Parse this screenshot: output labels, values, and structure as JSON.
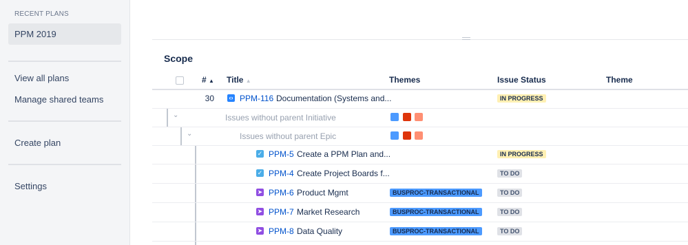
{
  "sidebar": {
    "heading": "RECENT PLANS",
    "active_plan": "PPM 2019",
    "links": {
      "view_all": "View all plans",
      "manage_teams": "Manage shared teams",
      "create": "Create plan",
      "settings": "Settings"
    }
  },
  "main": {
    "section_title": "Scope",
    "columns": {
      "num": "#",
      "title": "Title",
      "themes": "Themes",
      "status": "Issue Status",
      "theme": "Theme"
    },
    "rows": [
      {
        "type": "issue",
        "num": "30",
        "icon": "epic-icon",
        "key": "PPM-116",
        "title": "Documentation (Systems and...",
        "status": "IN PROGRESS",
        "theme_tag": ""
      },
      {
        "type": "group",
        "label": "Issues without parent Initiative"
      },
      {
        "type": "group",
        "label": "Issues without parent Epic"
      },
      {
        "type": "issue",
        "icon": "task-checkbox-icon",
        "key": "PPM-5",
        "title": "Create a PPM Plan and...",
        "status": "IN PROGRESS",
        "theme_tag": ""
      },
      {
        "type": "issue",
        "icon": "task-checkbox-icon",
        "key": "PPM-4",
        "title": "Create Project Boards f...",
        "status": "TO DO",
        "theme_tag": ""
      },
      {
        "type": "issue",
        "icon": "story-bolt-icon",
        "key": "PPM-6",
        "title": "Product Mgmt",
        "status": "TO DO",
        "theme_tag": "BUSPROC-TRANSACTIONAL"
      },
      {
        "type": "issue",
        "icon": "story-bolt-icon",
        "key": "PPM-7",
        "title": "Market Research",
        "status": "TO DO",
        "theme_tag": "BUSPROC-TRANSACTIONAL"
      },
      {
        "type": "issue",
        "icon": "story-bolt-icon",
        "key": "PPM-8",
        "title": "Data Quality",
        "status": "TO DO",
        "theme_tag": "BUSPROC-TRANSACTIONAL"
      }
    ],
    "theme_colors": [
      "#4c9aff",
      "#de350b",
      "#ff8f73"
    ],
    "status_colors": {
      "in_progress": "#fff0b3",
      "todo": "#dfe1e6",
      "theme_tag": "#4c9aff"
    }
  }
}
